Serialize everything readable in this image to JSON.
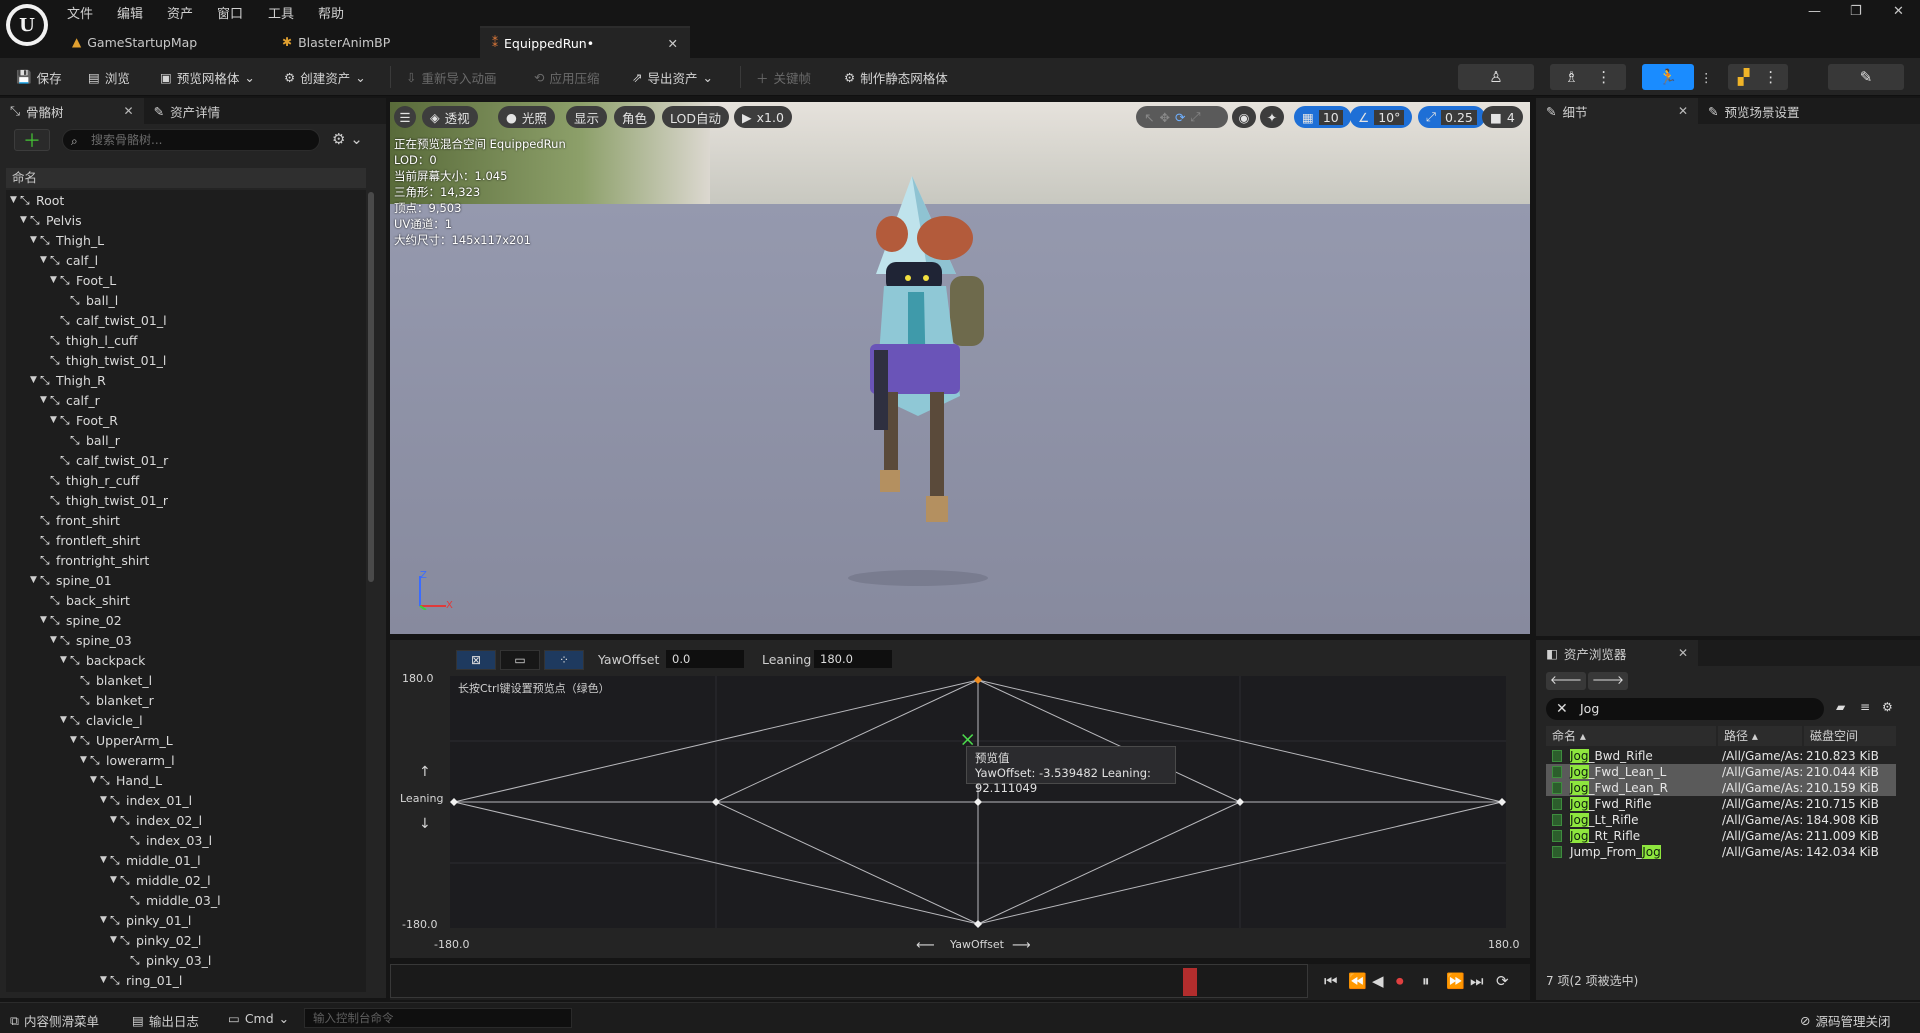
{
  "menu": [
    "文件",
    "编辑",
    "资产",
    "窗口",
    "工具",
    "帮助"
  ],
  "tabs": [
    {
      "label": "GameStartupMap",
      "icon": "level-icon"
    },
    {
      "label": "BlasterAnimBP",
      "icon": "anim-blueprint-icon"
    },
    {
      "label": "EquippedRun•",
      "icon": "blendspace-icon"
    }
  ],
  "toolbar": {
    "save": "保存",
    "browse": "浏览",
    "preview_mesh": "预览网格体",
    "create_asset": "创建资产",
    "reimport": "重新导入动画",
    "apply_compression": "应用压缩",
    "export_asset": "导出资产",
    "keyframe": "关键帧",
    "make_static_mesh": "制作静态网格体"
  },
  "left_panel": {
    "tab_skeleton": "骨骼树",
    "tab_asset_details": "资产详情",
    "search_placeholder": "搜索骨骼树...",
    "column_name": "命名",
    "bones": [
      {
        "name": "Root",
        "depth": 0,
        "expanded": true
      },
      {
        "name": "Pelvis",
        "depth": 1,
        "expanded": true
      },
      {
        "name": "Thigh_L",
        "depth": 2,
        "expanded": true
      },
      {
        "name": "calf_l",
        "depth": 3,
        "expanded": true
      },
      {
        "name": "Foot_L",
        "depth": 4,
        "expanded": true
      },
      {
        "name": "ball_l",
        "depth": 5,
        "expanded": false
      },
      {
        "name": "calf_twist_01_l",
        "depth": 4,
        "expanded": false
      },
      {
        "name": "thigh_l_cuff",
        "depth": 3,
        "expanded": false
      },
      {
        "name": "thigh_twist_01_l",
        "depth": 3,
        "expanded": false
      },
      {
        "name": "Thigh_R",
        "depth": 2,
        "expanded": true
      },
      {
        "name": "calf_r",
        "depth": 3,
        "expanded": true
      },
      {
        "name": "Foot_R",
        "depth": 4,
        "expanded": true
      },
      {
        "name": "ball_r",
        "depth": 5,
        "expanded": false
      },
      {
        "name": "calf_twist_01_r",
        "depth": 4,
        "expanded": false
      },
      {
        "name": "thigh_r_cuff",
        "depth": 3,
        "expanded": false
      },
      {
        "name": "thigh_twist_01_r",
        "depth": 3,
        "expanded": false
      },
      {
        "name": "front_shirt",
        "depth": 2,
        "expanded": false
      },
      {
        "name": "frontleft_shirt",
        "depth": 2,
        "expanded": false
      },
      {
        "name": "frontright_shirt",
        "depth": 2,
        "expanded": false
      },
      {
        "name": "spine_01",
        "depth": 2,
        "expanded": true
      },
      {
        "name": "back_shirt",
        "depth": 3,
        "expanded": false
      },
      {
        "name": "spine_02",
        "depth": 3,
        "expanded": true
      },
      {
        "name": "spine_03",
        "depth": 4,
        "expanded": true
      },
      {
        "name": "backpack",
        "depth": 5,
        "expanded": true
      },
      {
        "name": "blanket_l",
        "depth": 6,
        "expanded": false
      },
      {
        "name": "blanket_r",
        "depth": 6,
        "expanded": false
      },
      {
        "name": "clavicle_l",
        "depth": 5,
        "expanded": true
      },
      {
        "name": "UpperArm_L",
        "depth": 6,
        "expanded": true
      },
      {
        "name": "lowerarm_l",
        "depth": 7,
        "expanded": true
      },
      {
        "name": "Hand_L",
        "depth": 8,
        "expanded": true
      },
      {
        "name": "index_01_l",
        "depth": 9,
        "expanded": true
      },
      {
        "name": "index_02_l",
        "depth": 10,
        "expanded": true
      },
      {
        "name": "index_03_l",
        "depth": 11,
        "expanded": false
      },
      {
        "name": "middle_01_l",
        "depth": 9,
        "expanded": true
      },
      {
        "name": "middle_02_l",
        "depth": 10,
        "expanded": true
      },
      {
        "name": "middle_03_l",
        "depth": 11,
        "expanded": false
      },
      {
        "name": "pinky_01_l",
        "depth": 9,
        "expanded": true
      },
      {
        "name": "pinky_02_l",
        "depth": 10,
        "expanded": true
      },
      {
        "name": "pinky_03_l",
        "depth": 11,
        "expanded": false
      },
      {
        "name": "ring_01_l",
        "depth": 9,
        "expanded": true
      }
    ]
  },
  "viewport": {
    "perspective": "透视",
    "lighting": "光照",
    "show": "显示",
    "character": "角色",
    "lod": "LOD自动",
    "play_rate": "x1.0",
    "grid_size": "10",
    "rotation_snap": "10°",
    "scale_snap": "0.25",
    "camera_speed": "4",
    "info": [
      "正在预览混合空间 EquippedRun",
      "LOD：0",
      "当前屏幕大小：1.045",
      "三角形：14,323",
      "顶点：9,503",
      "UV通道：1",
      "大约尺寸：145x117x201"
    ]
  },
  "blend_space": {
    "x_param": "YawOffset",
    "x_value": "0.0",
    "y_param": "Leaning",
    "y_value": "180.0",
    "hint": "长按Ctrl键设置预览点（绿色）",
    "y_max": "180.0",
    "y_min": "-180.0",
    "x_min": "-180.0",
    "x_max": "180.0",
    "y_axis_label": "Leaning",
    "x_axis_label": "YawOffset",
    "tooltip_title": "预览值",
    "tooltip_value": "YawOffset: -3.539482  Leaning: 92.111049",
    "preview_point": {
      "yaw": -3.539482,
      "leaning": 92.111049
    },
    "samples": [
      {
        "yaw": 0,
        "leaning": 180
      },
      {
        "yaw": -180,
        "leaning": 0
      },
      {
        "yaw": -90,
        "leaning": 0
      },
      {
        "yaw": 0,
        "leaning": 0
      },
      {
        "yaw": 90,
        "leaning": 0
      },
      {
        "yaw": 180,
        "leaning": 0
      },
      {
        "yaw": 0,
        "leaning": -180
      }
    ]
  },
  "details_panel": {
    "tab_details": "细节",
    "tab_preview_scene": "预览场景设置"
  },
  "asset_browser": {
    "tab": "资产浏览器",
    "search_value": "Jog",
    "col_name": "命名",
    "col_path": "路径",
    "col_size": "磁盘空间",
    "highlight": "Jog",
    "rows": [
      {
        "prefix": "",
        "hl": "Jog",
        "suffix": "_Bwd_Rifle",
        "path": "/All/Game/As:",
        "size": "210.823 KiB",
        "selected": false
      },
      {
        "prefix": "",
        "hl": "Jog",
        "suffix": "_Fwd_Lean_L",
        "path": "/All/Game/As:",
        "size": "210.044 KiB",
        "selected": true
      },
      {
        "prefix": "",
        "hl": "Jog",
        "suffix": "_Fwd_Lean_R",
        "path": "/All/Game/As:",
        "size": "210.159 KiB",
        "selected": true
      },
      {
        "prefix": "",
        "hl": "Jog",
        "suffix": "_Fwd_Rifle",
        "path": "/All/Game/As:",
        "size": "210.715 KiB",
        "selected": false
      },
      {
        "prefix": "",
        "hl": "Jog",
        "suffix": "_Lt_Rifle",
        "path": "/All/Game/As:",
        "size": "184.908 KiB",
        "selected": false
      },
      {
        "prefix": "",
        "hl": "Jog",
        "suffix": "_Rt_Rifle",
        "path": "/All/Game/As:",
        "size": "211.009 KiB",
        "selected": false
      },
      {
        "prefix": "Jump_From_",
        "hl": "Jog",
        "suffix": "",
        "path": "/All/Game/As:",
        "size": "142.034 KiB",
        "selected": false
      }
    ],
    "count": "7 项(2 项被选中)"
  },
  "statusbar": {
    "content_drawer": "内容侧滑菜单",
    "output_log": "输出日志",
    "cmd": "Cmd",
    "cmd_placeholder": "输入控制台命令",
    "source_control": "源码管理关闭"
  }
}
